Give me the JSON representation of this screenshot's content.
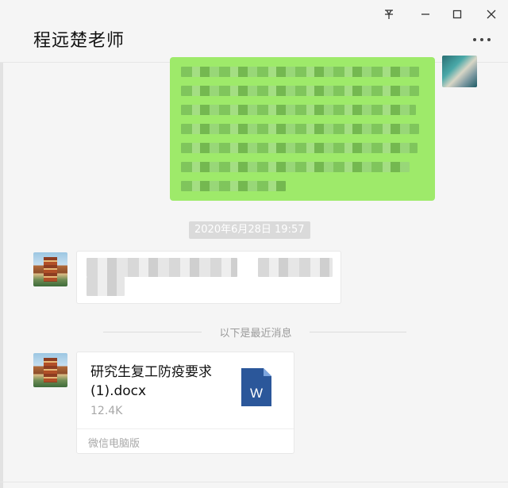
{
  "window": {
    "title": "程远楚老师",
    "controls": {
      "pin_icon": "pin-icon",
      "minimize_icon": "minimize-icon",
      "maximize_icon": "maximize-icon",
      "close_icon": "close-icon",
      "more_icon": "more-icon"
    }
  },
  "messages": {
    "sent_bubble_color": "#9eea6a",
    "timestamp": "2020年6月28日 19:57",
    "divider_text": "以下是最近消息",
    "file": {
      "name": "研究生复工防疫要求(1).docx",
      "size": "12.4K",
      "source": "微信电脑版",
      "icon": "word-document-icon",
      "icon_letter": "W",
      "icon_color": "#2b579a"
    }
  }
}
